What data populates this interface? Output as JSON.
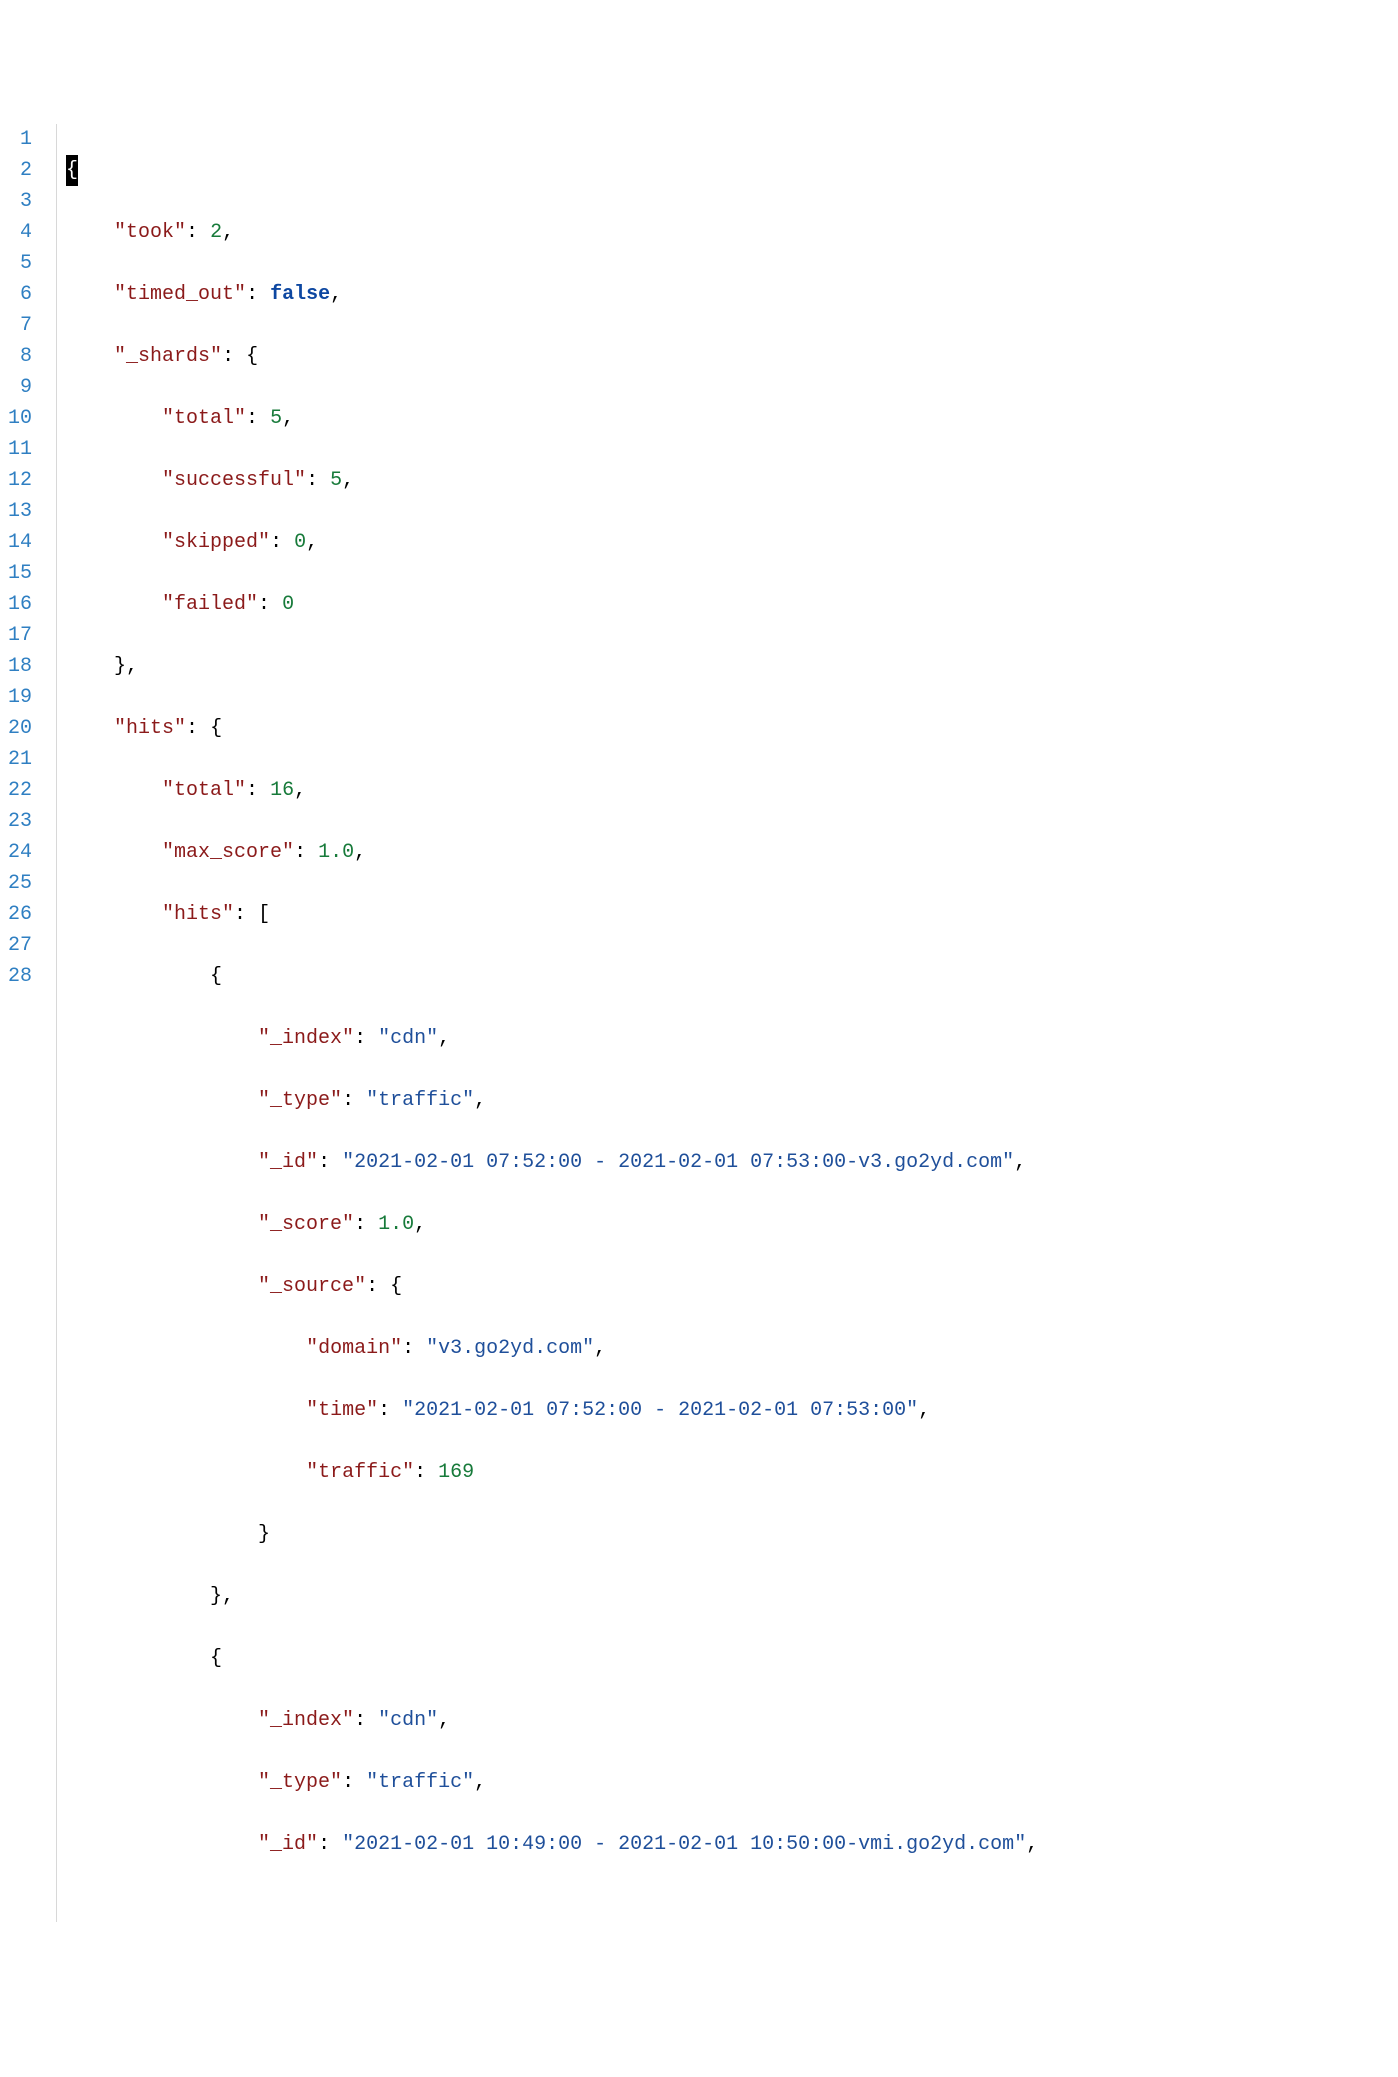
{
  "gutter": {
    "start": 1,
    "end": 28
  },
  "code": {
    "l1": {
      "brace": "{"
    },
    "l2": {
      "key": "\"took\"",
      "colon": ": ",
      "num": "2",
      "comma": ","
    },
    "l3": {
      "key": "\"timed_out\"",
      "colon": ": ",
      "bool": "false",
      "comma": ","
    },
    "l4": {
      "key": "\"_shards\"",
      "colon": ": ",
      "brace": "{"
    },
    "l5": {
      "key": "\"total\"",
      "colon": ": ",
      "num": "5",
      "comma": ","
    },
    "l6": {
      "key": "\"successful\"",
      "colon": ": ",
      "num": "5",
      "comma": ","
    },
    "l7": {
      "key": "\"skipped\"",
      "colon": ": ",
      "num": "0",
      "comma": ","
    },
    "l8": {
      "key": "\"failed\"",
      "colon": ": ",
      "num": "0"
    },
    "l9": {
      "brace": "},",
      "text": "},"
    },
    "l10": {
      "key": "\"hits\"",
      "colon": ": ",
      "brace": "{"
    },
    "l11": {
      "key": "\"total\"",
      "colon": ": ",
      "num": "16",
      "comma": ","
    },
    "l12": {
      "key": "\"max_score\"",
      "colon": ": ",
      "num": "1.0",
      "comma": ","
    },
    "l13": {
      "key": "\"hits\"",
      "colon": ": ",
      "bracket": "["
    },
    "l14": {
      "brace": "{"
    },
    "l15": {
      "key": "\"_index\"",
      "colon": ": ",
      "str": "\"cdn\"",
      "comma": ","
    },
    "l16": {
      "key": "\"_type\"",
      "colon": ": ",
      "str": "\"traffic\"",
      "comma": ","
    },
    "l17": {
      "key": "\"_id\"",
      "colon": ": ",
      "str": "\"2021-02-01 07:52:00 - 2021-02-01 07:53:00-v3.go2yd.com\"",
      "comma": ","
    },
    "l18": {
      "key": "\"_score\"",
      "colon": ": ",
      "num": "1.0",
      "comma": ","
    },
    "l19": {
      "key": "\"_source\"",
      "colon": ": ",
      "brace": "{"
    },
    "l20": {
      "key": "\"domain\"",
      "colon": ": ",
      "str": "\"v3.go2yd.com\"",
      "comma": ","
    },
    "l21": {
      "key": "\"time\"",
      "colon": ": ",
      "str": "\"2021-02-01 07:52:00 - 2021-02-01 07:53:00\"",
      "comma": ","
    },
    "l22": {
      "key": "\"traffic\"",
      "colon": ": ",
      "num": "169"
    },
    "l23": {
      "brace": "}"
    },
    "l24": {
      "brace": "},"
    },
    "l25": {
      "brace": "{"
    },
    "l26": {
      "key": "\"_index\"",
      "colon": ": ",
      "str": "\"cdn\"",
      "comma": ","
    },
    "l27": {
      "key": "\"_type\"",
      "colon": ": ",
      "str": "\"traffic\"",
      "comma": ","
    },
    "l28": {
      "key": "\"_id\"",
      "colon": ": ",
      "str": "\"2021-02-01 10:49:00 - 2021-02-01 10:50:00-vmi.go2yd.com\"",
      "comma": ","
    }
  },
  "indent": {
    "i1": "    ",
    "i2": "        ",
    "i3": "            ",
    "i4": "                ",
    "i5": "                    "
  }
}
